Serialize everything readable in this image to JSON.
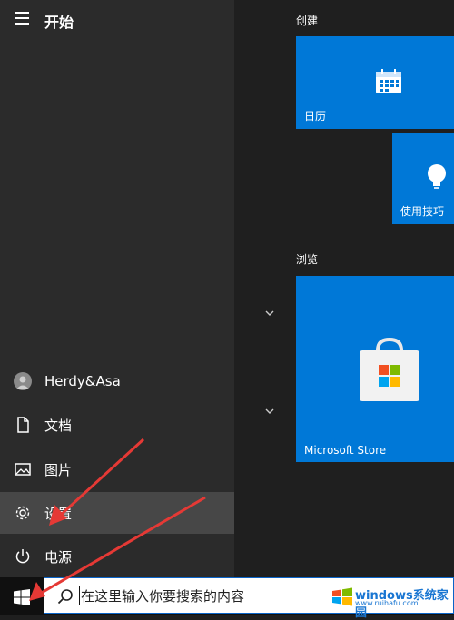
{
  "start": {
    "title": "开始"
  },
  "nav": {
    "user": "Herdy&Asa",
    "documents": "文档",
    "pictures": "图片",
    "settings": "设置",
    "power": "电源"
  },
  "groups": {
    "create": "创建",
    "browse": "浏览"
  },
  "tiles": {
    "calendar": "日历",
    "tips": "使用技巧",
    "store": "Microsoft Store"
  },
  "search": {
    "placeholder": "在这里输入你要搜索的内容"
  },
  "watermark": {
    "brand": "windows系统家园",
    "url": "www.ruihafu.com"
  },
  "colors": {
    "tile_blue": "#0078d7",
    "annotation_red": "#e53935"
  }
}
